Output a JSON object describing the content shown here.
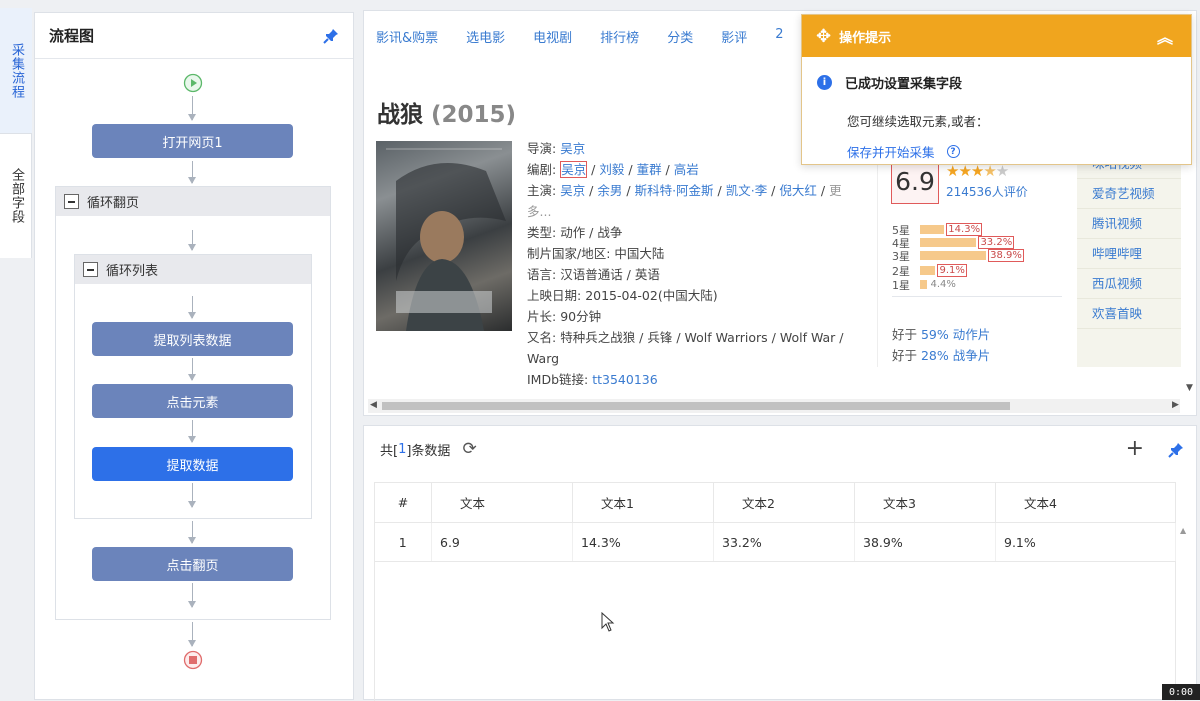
{
  "vertical_tabs": {
    "collect_flow": "采集流程",
    "all_fields": "全部字段"
  },
  "flow": {
    "title": "流程图",
    "open_page": "打开网页1",
    "loop_page": "循环翻页",
    "loop_list": "循环列表",
    "extract_list": "提取列表数据",
    "click_element": "点击元素",
    "extract_data": "提取数据",
    "click_next": "点击翻页"
  },
  "web": {
    "nav": [
      "影讯&购票",
      "选电影",
      "电视剧",
      "排行榜",
      "分类",
      "影评",
      "2"
    ],
    "title": "战狼",
    "year": "(2015)",
    "info": {
      "director_label": "导演: ",
      "director": "吴京",
      "writer_label": "编剧: ",
      "writer1": "吴京",
      "writer_rest": "刘毅",
      "writer3": "董群",
      "writer4": "高岩",
      "cast_label": "主演: ",
      "cast1": "吴京",
      "cast2": "余男",
      "cast3": "斯科特·阿金斯",
      "cast4": "凯文·李",
      "cast5": "倪大红",
      "more": "更多...",
      "genre_label": "类型: ",
      "genre": "动作 / 战争",
      "country_label": "制片国家/地区: ",
      "country": "中国大陆",
      "lang_label": "语言: ",
      "lang": "汉语普通话 / 英语",
      "release_label": "上映日期: ",
      "release": "2015-04-02(中国大陆)",
      "length_label": "片长: ",
      "length": "90分钟",
      "aka_label": "又名: ",
      "aka": "特种兵之战狼 / 兵锋 / Wolf Warriors / Wolf War / Warg",
      "imdb_label": "IMDb链接: ",
      "imdb": "tt3540136"
    },
    "rating": {
      "score": "6.9",
      "stars": "★★★",
      "half_star": "★",
      "off_stars": "★",
      "votes": "214536人评价",
      "rows": [
        {
          "label": "5星",
          "pct": "14.3%",
          "value": 14.3
        },
        {
          "label": "4星",
          "pct": "33.2%",
          "value": 33.2
        },
        {
          "label": "3星",
          "pct": "38.9%",
          "value": 38.9
        },
        {
          "label": "2星",
          "pct": "9.1%",
          "value": 9.1
        },
        {
          "label": "1星",
          "pct": "4.4%",
          "value": 4.4
        }
      ],
      "better1_prefix": "好于 ",
      "better1_pct": "59% 动作片",
      "better2_prefix": "好于 ",
      "better2_pct": "28% 战争片"
    },
    "side_links": [
      "咪咕视频",
      "爱奇艺视频",
      "腾讯视频",
      "哔哩哔哩",
      "西瓜视频",
      "欢喜首映"
    ]
  },
  "tip": {
    "header": "操作提示",
    "success": "已成功设置采集字段",
    "continue": "您可继续选取元素,或者：",
    "save_start": "保存并开始采集"
  },
  "data_panel": {
    "count_prefix": "共[",
    "count": "1",
    "count_suffix": "]条数据",
    "columns": [
      "#",
      "文本",
      "文本1",
      "文本2",
      "文本3",
      "文本4"
    ],
    "rows": [
      [
        "1",
        "6.9",
        "14.3%",
        "33.2%",
        "38.9%",
        "9.1%"
      ]
    ]
  },
  "timer": "0:00",
  "colors": {
    "accent": "#2d70e8",
    "node": "#6b84bb",
    "tip_header": "#f0a51e",
    "link": "#3a7bd0",
    "highlight_border": "#e05a5a"
  }
}
